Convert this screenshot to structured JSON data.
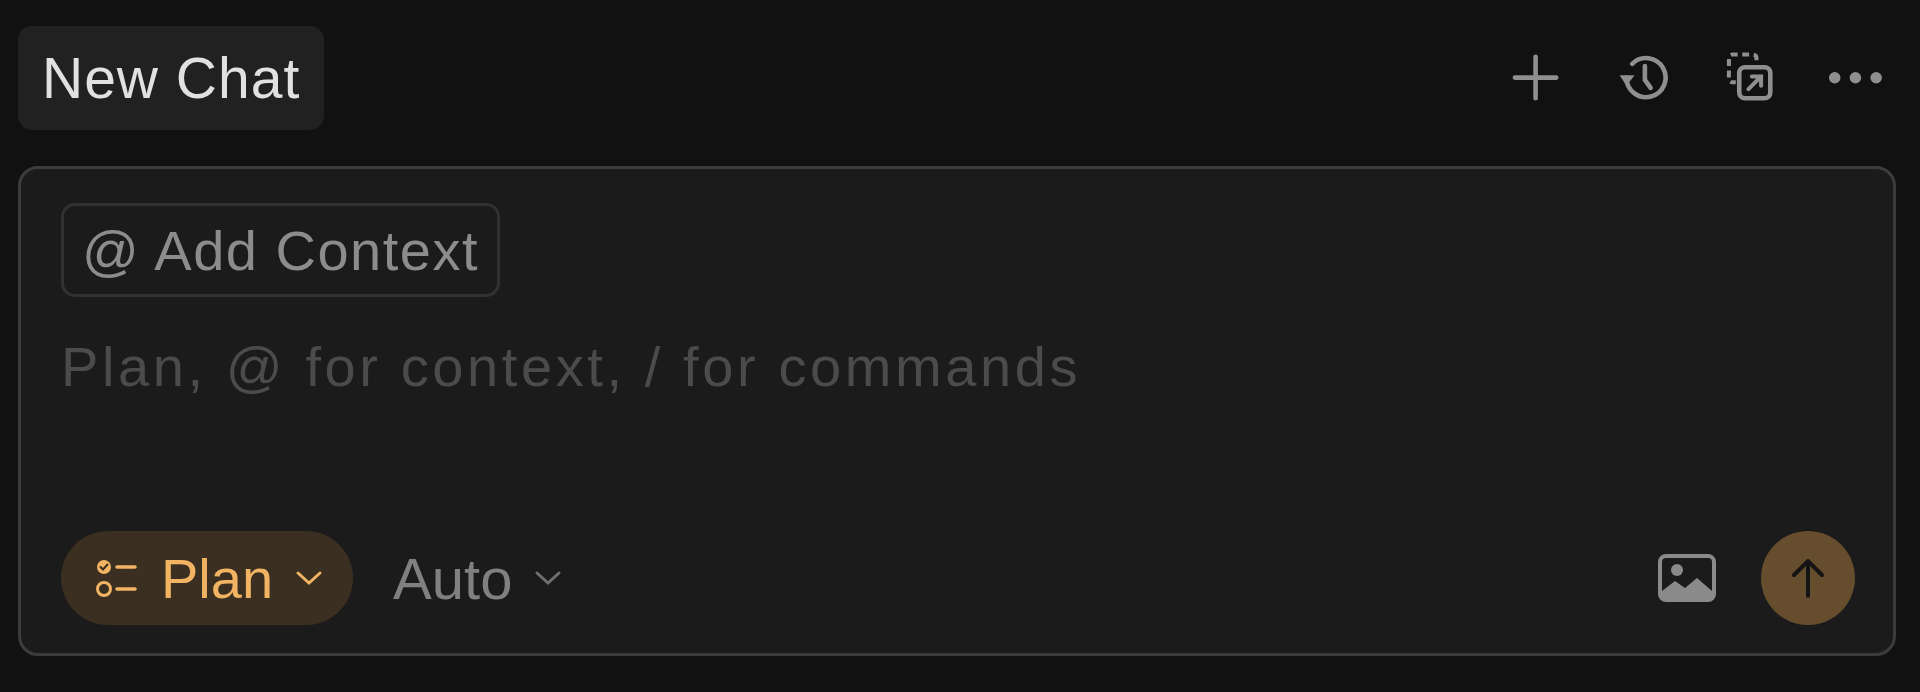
{
  "header": {
    "tabs": [
      {
        "label": "New Chat",
        "selected": true
      }
    ],
    "actions": [
      {
        "kind": "plus"
      },
      {
        "kind": "history"
      },
      {
        "kind": "popout"
      },
      {
        "kind": "more"
      }
    ]
  },
  "composer": {
    "context_button": {
      "icon": "@",
      "label": "Add Context"
    },
    "input": {
      "placeholder": "Plan, @ for context, / for commands"
    },
    "mode": {
      "label": "Plan",
      "active": true
    },
    "model": {
      "label": "Auto"
    },
    "send": {
      "disabled": true
    }
  }
}
